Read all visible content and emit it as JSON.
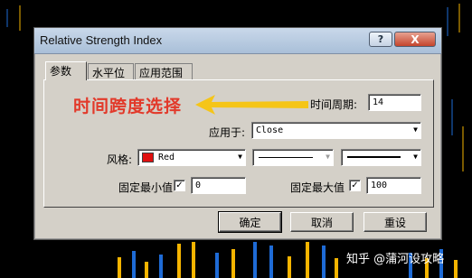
{
  "window": {
    "title": "Relative Strength Index",
    "help_label": "?",
    "close_label": "X"
  },
  "tabs": [
    {
      "label": "参数",
      "active": true
    },
    {
      "label": "水平位",
      "active": false
    },
    {
      "label": "应用范围",
      "active": false
    }
  ],
  "annotation": {
    "text": "时间跨度选择",
    "color": "#e2392a",
    "arrow_color": "#f5c518"
  },
  "form": {
    "period_label": "时间周期:",
    "period_value": "14",
    "apply_to_label": "应用于:",
    "apply_to_value": "Close",
    "style_label": "风格:",
    "style_color_name": "Red",
    "style_color_hex": "#e01010",
    "fixed_min_label": "固定最小值",
    "fixed_min_checked": true,
    "fixed_min_value": "0",
    "fixed_max_label": "固定最大值",
    "fixed_max_checked": true,
    "fixed_max_value": "100"
  },
  "buttons": {
    "ok": "确定",
    "cancel": "取消",
    "reset": "重设"
  },
  "watermark": {
    "text": "知乎 @蒲河设攻略"
  }
}
